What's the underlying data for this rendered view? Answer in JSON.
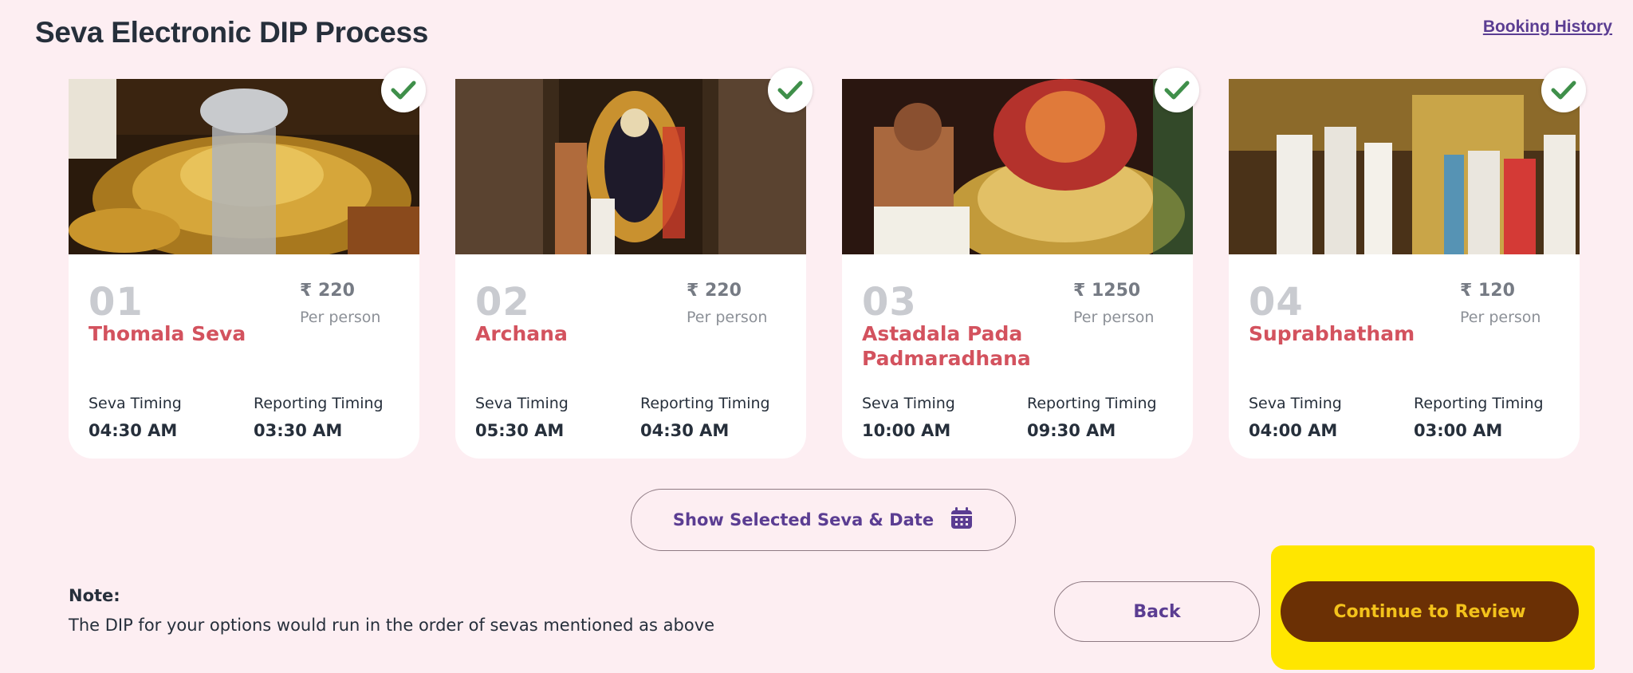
{
  "header": {
    "title": "Seva Electronic DIP Process",
    "booking_history": "Booking History"
  },
  "labels": {
    "per_person": "Per person",
    "seva_timing": "Seva Timing",
    "reporting_timing": "Reporting Timing",
    "currency": "₹"
  },
  "sevas": [
    {
      "number": "01",
      "name": "Thomala Seva",
      "price": "₹ 220",
      "seva_time": "04:30 AM",
      "reporting_time": "03:30 AM",
      "selected": true
    },
    {
      "number": "02",
      "name": "Archana",
      "price": "₹ 220",
      "seva_time": "05:30 AM",
      "reporting_time": "04:30 AM",
      "selected": true
    },
    {
      "number": "03",
      "name": "Astadala Pada Padmaradhana",
      "price": "₹ 1250",
      "seva_time": "10:00 AM",
      "reporting_time": "09:30 AM",
      "selected": true
    },
    {
      "number": "04",
      "name": "Suprabhatham",
      "price": "₹ 120",
      "seva_time": "04:00 AM",
      "reporting_time": "03:00 AM",
      "selected": true
    }
  ],
  "actions": {
    "show_selected": "Show Selected Seva & Date",
    "back": "Back",
    "continue": "Continue to Review"
  },
  "note": {
    "title": "Note:",
    "text": "The DIP for your options would run in the order of sevas mentioned as above"
  },
  "colors": {
    "background": "#fdeef2",
    "accent_purple": "#5b3d92",
    "seva_name_red": "#d3525e",
    "continue_bg": "#6b3005",
    "continue_text": "#f3c21b",
    "highlight": "#ffe600",
    "check_green": "#3f8f4a"
  },
  "icons": {
    "check": "check-icon",
    "calendar": "calendar-icon"
  }
}
